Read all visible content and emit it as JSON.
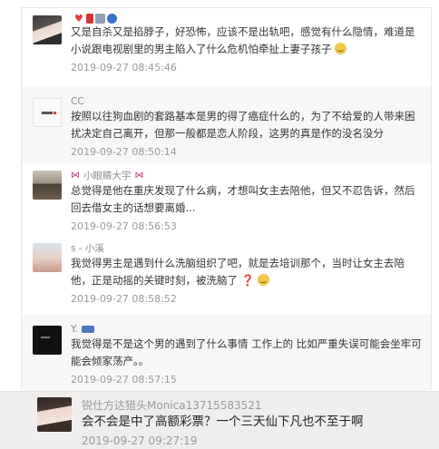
{
  "comments": [
    {
      "username": "",
      "text": "又是自杀又是掐脖子，好恐怖，应该不是出轨吧，感觉有什么隐情，难道是小说跟电视剧里的男主陷入了什么危机怕牵扯上妻子孩子",
      "time": "2019-09-27 08:45:46",
      "avatar_icon": "woman-photo-avatar",
      "badges": [
        "heart-badge",
        "red-bottle-badge",
        "message-badge",
        "blue-emblem-badge"
      ],
      "trailing_emoji": "grin-emoji"
    },
    {
      "username": "CC",
      "text": "按照以往狗血剧的套路基本是男的得了癌症什么的，为了不给爱的人带来困扰决定自己离开，但那一般都是恋人阶段，这男的真是作的没名没分",
      "time": "2019-09-27 08:50:14",
      "avatar_icon": "default-placeholder-avatar"
    },
    {
      "username": "小眼睛大宇",
      "text": "总觉得是他在重庆发现了什么病，才想叫女主去陪他，但又不忍告诉，然后回去借女主的话想要离婚...",
      "time": "2019-09-27 08:56:53",
      "avatar_icon": "man-photo-avatar",
      "badges": [
        "bow-badge-left",
        "bow-badge-right"
      ]
    },
    {
      "username": "s - 小溪",
      "text": "我觉得男主是遇到什么洗脑组织了吧，就是去培训那个，当时让女主去陪他，正是动摇的关键时刻，被洗脑了",
      "time": "2019-09-27 08:58:52",
      "avatar_icon": "child-photo-avatar",
      "trailing_emoji": "wink-emoji"
    },
    {
      "username": "Y.",
      "text": "我觉得是不是这个男的遇到了什么事情 工作上的 比如严重失误可能会坐牢可能会倾家荡产。。",
      "time": "2019-09-27 08:57:15",
      "avatar_icon": "dark-image-avatar"
    }
  ],
  "bottom_comment": {
    "username": "锐仕方达猎头Monica13715583521",
    "text": "会不会是中了高额彩票？一个三天仙下凡也不至于啊",
    "time": "2019-09-27 09:27:19",
    "avatar_icon": "woman-selfie-avatar"
  }
}
